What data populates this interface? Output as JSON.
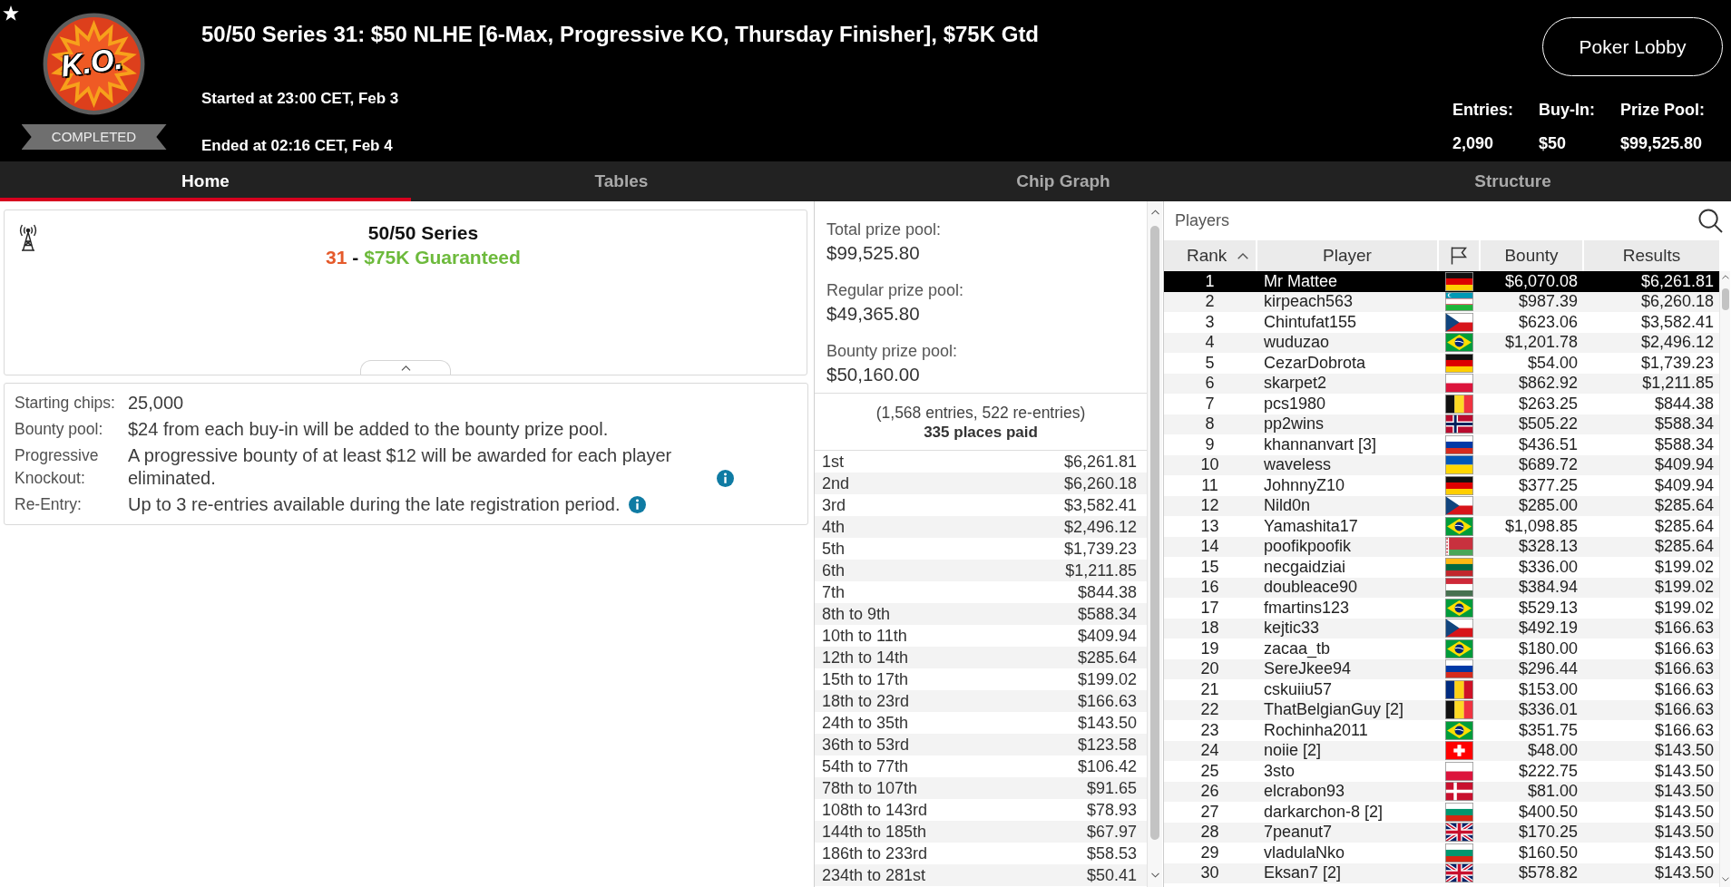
{
  "header": {
    "logo_text": "K.O.",
    "status": "COMPLETED",
    "title": "50/50 Series 31: $50 NLHE [6-Max, Progressive KO, Thursday Finisher], $75K Gtd",
    "started": "Started at 23:00 CET, Feb 3",
    "ended": "Ended at 02:16 CET, Feb 4",
    "lobby_button": "Poker Lobby",
    "stats": [
      {
        "label": "Entries:",
        "value": "2,090"
      },
      {
        "label": "Buy-In:",
        "value": "$50"
      },
      {
        "label": "Prize Pool:",
        "value": "$99,525.80"
      }
    ]
  },
  "tabs": [
    {
      "label": "Home",
      "selected": true
    },
    {
      "label": "Tables",
      "selected": false
    },
    {
      "label": "Chip Graph",
      "selected": false
    },
    {
      "label": "Structure",
      "selected": false
    }
  ],
  "series_card": {
    "heading": "50/50 Series",
    "number": "31",
    "separator": "-",
    "guarantee": "$75K Guaranteed"
  },
  "details": [
    {
      "label": "Starting chips:",
      "value": "25,000",
      "info": false
    },
    {
      "label": "Bounty pool:",
      "value": "$24 from each buy-in will be added to the bounty prize pool.",
      "info": false
    },
    {
      "label": "Progressive Knockout:",
      "value": "A progressive bounty of at least $12 will be awarded for each player eliminated.",
      "info": true
    },
    {
      "label": "Re-Entry:",
      "value": "Up to 3 re-entries available during the late registration period.",
      "info": true
    }
  ],
  "prize_panel": {
    "pools": [
      {
        "label": "Total prize pool:",
        "value": "$99,525.80"
      },
      {
        "label": "Regular prize pool:",
        "value": "$49,365.80"
      },
      {
        "label": "Bounty prize pool:",
        "value": "$50,160.00"
      }
    ],
    "entries_note": "(1,568 entries, 522 re-entries)",
    "places_paid": "335 places paid",
    "payouts": [
      {
        "place": "1st",
        "amount": "$6,261.81"
      },
      {
        "place": "2nd",
        "amount": "$6,260.18"
      },
      {
        "place": "3rd",
        "amount": "$3,582.41"
      },
      {
        "place": "4th",
        "amount": "$2,496.12"
      },
      {
        "place": "5th",
        "amount": "$1,739.23"
      },
      {
        "place": "6th",
        "amount": "$1,211.85"
      },
      {
        "place": "7th",
        "amount": "$844.38"
      },
      {
        "place": "8th to 9th",
        "amount": "$588.34"
      },
      {
        "place": "10th to 11th",
        "amount": "$409.94"
      },
      {
        "place": "12th to 14th",
        "amount": "$285.64"
      },
      {
        "place": "15th to 17th",
        "amount": "$199.02"
      },
      {
        "place": "18th to 23rd",
        "amount": "$166.63"
      },
      {
        "place": "24th to 35th",
        "amount": "$143.50"
      },
      {
        "place": "36th to 53rd",
        "amount": "$123.58"
      },
      {
        "place": "54th to 77th",
        "amount": "$106.42"
      },
      {
        "place": "78th to 107th",
        "amount": "$91.65"
      },
      {
        "place": "108th to 143rd",
        "amount": "$78.93"
      },
      {
        "place": "144th to 185th",
        "amount": "$67.97"
      },
      {
        "place": "186th to 233rd",
        "amount": "$58.53"
      },
      {
        "place": "234th to 281st",
        "amount": "$50.41"
      }
    ]
  },
  "players": {
    "title": "Players",
    "columns": [
      {
        "kind": "text",
        "label": "Rank",
        "sorted": true
      },
      {
        "kind": "text",
        "label": "Player",
        "sorted": false
      },
      {
        "kind": "flag",
        "sorted": false
      },
      {
        "kind": "text",
        "label": "Bounty",
        "sorted": false
      },
      {
        "kind": "text",
        "label": "Results",
        "sorted": false
      }
    ],
    "rows": [
      {
        "rank": "1",
        "player": "Mr Mattee",
        "flag": {
          "kind": "germany"
        },
        "bounty": "$6,070.08",
        "result": "$6,261.81",
        "selected": true
      },
      {
        "rank": "2",
        "player": "kirpeach563",
        "flag": {
          "kind": "uzbekistan"
        },
        "bounty": "$987.39",
        "result": "$6,260.18",
        "selected": false
      },
      {
        "rank": "3",
        "player": "Chintufat155",
        "flag": {
          "kind": "czechia"
        },
        "bounty": "$623.06",
        "result": "$3,582.41",
        "selected": false
      },
      {
        "rank": "4",
        "player": "wuduzao",
        "flag": {
          "kind": "brazil"
        },
        "bounty": "$1,201.78",
        "result": "$2,496.12",
        "selected": false
      },
      {
        "rank": "5",
        "player": "CezarDobrota",
        "flag": {
          "kind": "germany"
        },
        "bounty": "$54.00",
        "result": "$1,739.23",
        "selected": false
      },
      {
        "rank": "6",
        "player": "skarpet2",
        "flag": {
          "kind": "poland"
        },
        "bounty": "$862.92",
        "result": "$1,211.85",
        "selected": false
      },
      {
        "rank": "7",
        "player": "pcs1980",
        "flag": {
          "kind": "belgium"
        },
        "bounty": "$263.25",
        "result": "$844.38",
        "selected": false
      },
      {
        "rank": "8",
        "player": "pp2wins",
        "flag": {
          "kind": "norway"
        },
        "bounty": "$505.22",
        "result": "$588.34",
        "selected": false
      },
      {
        "rank": "9",
        "player": "khannanvart [3]",
        "flag": {
          "kind": "russia"
        },
        "bounty": "$436.51",
        "result": "$588.34",
        "selected": false
      },
      {
        "rank": "10",
        "player": "waveless",
        "flag": {
          "kind": "ukraine"
        },
        "bounty": "$689.72",
        "result": "$409.94",
        "selected": false
      },
      {
        "rank": "11",
        "player": "JohnnyZ10",
        "flag": {
          "kind": "germany"
        },
        "bounty": "$377.25",
        "result": "$409.94",
        "selected": false
      },
      {
        "rank": "12",
        "player": "Nild0n",
        "flag": {
          "kind": "czechia"
        },
        "bounty": "$285.00",
        "result": "$285.64",
        "selected": false
      },
      {
        "rank": "13",
        "player": "Yamashita17",
        "flag": {
          "kind": "brazil"
        },
        "bounty": "$1,098.85",
        "result": "$285.64",
        "selected": false
      },
      {
        "rank": "14",
        "player": "poofikpoofik",
        "flag": {
          "kind": "belarus"
        },
        "bounty": "$328.13",
        "result": "$285.64",
        "selected": false
      },
      {
        "rank": "15",
        "player": "necgaidziai",
        "flag": {
          "kind": "lithuania"
        },
        "bounty": "$336.00",
        "result": "$199.02",
        "selected": false
      },
      {
        "rank": "16",
        "player": "doubleace90",
        "flag": {
          "kind": "hungary"
        },
        "bounty": "$384.94",
        "result": "$199.02",
        "selected": false
      },
      {
        "rank": "17",
        "player": "fmartins123",
        "flag": {
          "kind": "brazil"
        },
        "bounty": "$529.13",
        "result": "$199.02",
        "selected": false
      },
      {
        "rank": "18",
        "player": "kejtic33",
        "flag": {
          "kind": "czechia"
        },
        "bounty": "$492.19",
        "result": "$166.63",
        "selected": false
      },
      {
        "rank": "19",
        "player": "zacaa_tb",
        "flag": {
          "kind": "brazil"
        },
        "bounty": "$180.00",
        "result": "$166.63",
        "selected": false
      },
      {
        "rank": "20",
        "player": "SereJkee94",
        "flag": {
          "kind": "russia"
        },
        "bounty": "$296.44",
        "result": "$166.63",
        "selected": false
      },
      {
        "rank": "21",
        "player": "cskuiiu57",
        "flag": {
          "kind": "romania"
        },
        "bounty": "$153.00",
        "result": "$166.63",
        "selected": false
      },
      {
        "rank": "22",
        "player": "ThatBelgianGuy [2]",
        "flag": {
          "kind": "belgium"
        },
        "bounty": "$336.01",
        "result": "$166.63",
        "selected": false
      },
      {
        "rank": "23",
        "player": "Rochinha2011",
        "flag": {
          "kind": "brazil"
        },
        "bounty": "$351.75",
        "result": "$166.63",
        "selected": false
      },
      {
        "rank": "24",
        "player": "noiie [2]",
        "flag": {
          "kind": "switzerland"
        },
        "bounty": "$48.00",
        "result": "$143.50",
        "selected": false
      },
      {
        "rank": "25",
        "player": "3sto",
        "flag": {
          "kind": "poland"
        },
        "bounty": "$222.75",
        "result": "$143.50",
        "selected": false
      },
      {
        "rank": "26",
        "player": "elcrabon93",
        "flag": {
          "kind": "denmark"
        },
        "bounty": "$81.00",
        "result": "$143.50",
        "selected": false
      },
      {
        "rank": "27",
        "player": "darkarchon-8 [2]",
        "flag": {
          "kind": "bulgaria"
        },
        "bounty": "$400.50",
        "result": "$143.50",
        "selected": false
      },
      {
        "rank": "28",
        "player": "7peanut7",
        "flag": {
          "kind": "uk"
        },
        "bounty": "$170.25",
        "result": "$143.50",
        "selected": false
      },
      {
        "rank": "29",
        "player": "vladulaNko",
        "flag": {
          "kind": "bulgaria"
        },
        "bounty": "$160.50",
        "result": "$143.50",
        "selected": false
      },
      {
        "rank": "30",
        "player": "Eksan7 [2]",
        "flag": {
          "kind": "uk"
        },
        "bounty": "$578.82",
        "result": "$143.50",
        "selected": false
      }
    ]
  }
}
